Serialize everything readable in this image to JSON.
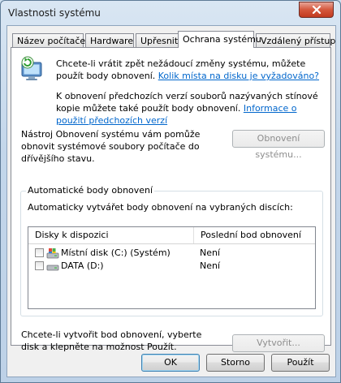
{
  "window": {
    "title": "Vlastnosti systému"
  },
  "tabs": [
    {
      "label": "Název počítače"
    },
    {
      "label": "Hardware"
    },
    {
      "label": "Upřesnit"
    },
    {
      "label": "Ochrana systému"
    },
    {
      "label": "Vzdálený přístup"
    }
  ],
  "intro": {
    "text": "Chcete-li vrátit zpět nežádoucí změny systému, můžete použít body obnovení.",
    "link": "Kolik místa na disku je vyžadováno?"
  },
  "shadow": {
    "text": "K obnovení předchozích verzí souborů nazývaných stínové kopie můžete také použít body obnovení.",
    "link": "Informace o použití předchozích verzí"
  },
  "restore": {
    "text": "Nástroj Obnovení systému vám pomůže obnovit systémové soubory počítače do dřívějšího stavu.",
    "button": "Obnovení systému..."
  },
  "auto": {
    "group_label": "Automatické body obnovení",
    "description": "Automaticky vytvářet body obnovení na vybraných discích:",
    "columns": [
      "Disky k dispozici",
      "Poslední bod obnovení"
    ],
    "disks": [
      {
        "name": "Místní disk (C:) (Systém)",
        "status": "Není",
        "checked": false,
        "icon": "system-drive-icon"
      },
      {
        "name": "DATA (D:)",
        "status": "Není",
        "checked": false,
        "icon": "drive-icon"
      }
    ]
  },
  "create": {
    "text": "Chcete-li vytvořit bod obnovení, vyberte disk a klepněte na možnost Použít.",
    "button": "Vytvořit..."
  },
  "footer": {
    "ok": "OK",
    "cancel": "Storno",
    "apply": "Použít"
  }
}
